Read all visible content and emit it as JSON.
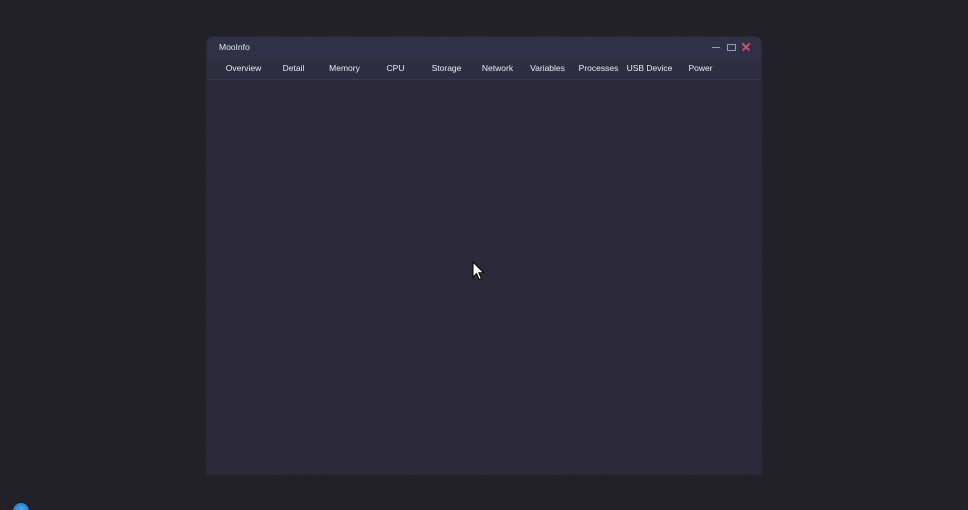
{
  "window": {
    "title": "MooInfo"
  },
  "tabs": [
    {
      "label": "Overview"
    },
    {
      "label": "Detail"
    },
    {
      "label": "Memory"
    },
    {
      "label": "CPU"
    },
    {
      "label": "Storage"
    },
    {
      "label": "Network"
    },
    {
      "label": "Variables"
    },
    {
      "label": "Processes"
    },
    {
      "label": "USB Device"
    },
    {
      "label": "Power"
    }
  ],
  "icons": {
    "minimize": "minimize-icon",
    "maximize": "maximize-icon",
    "close": "close-icon",
    "cursor": "mouse-cursor-icon",
    "taskbar": "app-taskbar-icon"
  },
  "colors": {
    "background": "#1f1e27",
    "window": "#2a2838",
    "titlebar": "#34324a",
    "close": "#c0556e",
    "text": "#eceaf4"
  }
}
